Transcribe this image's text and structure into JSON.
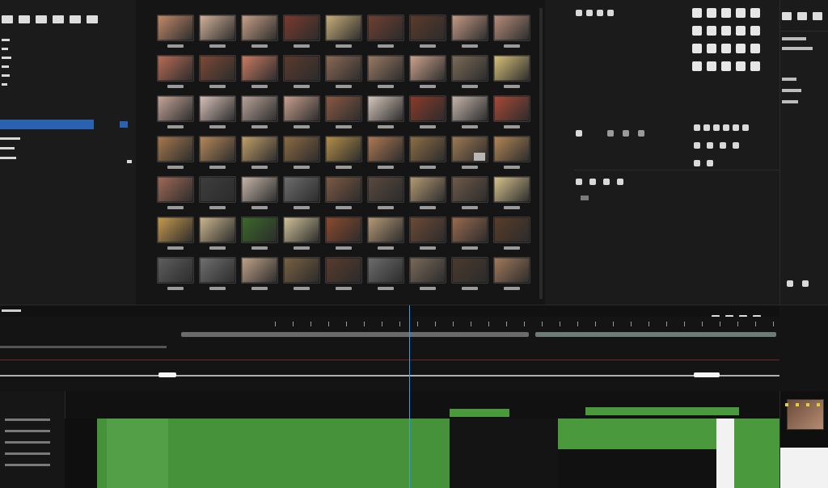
{
  "colors": {
    "bg": "#161616",
    "panel": "#1b1b1b",
    "selection": "#2a62b0",
    "accent_blue": "#2aa1ff",
    "accent_green": "#4a9a3d",
    "accent_yellow": "#e6d03a"
  },
  "icons": {
    "top_left_tabs": [
      "tab-icon",
      "tab-icon",
      "tab-icon",
      "tab-icon",
      "tab-icon",
      "tab-icon"
    ],
    "inspector_tools": [
      "tool-icon",
      "tool-icon",
      "tool-icon",
      "tool-icon",
      "tool-icon",
      "tool-icon",
      "tool-icon",
      "tool-icon",
      "tool-icon",
      "tool-icon",
      "tool-icon",
      "tool-icon",
      "tool-icon",
      "tool-icon",
      "tool-icon",
      "tool-icon",
      "tool-icon",
      "tool-icon",
      "tool-icon",
      "tool-icon"
    ],
    "inspector_small_tools": [
      "tool-icon",
      "tool-icon",
      "tool-icon",
      "tool-icon",
      "tool-icon",
      "tool-icon",
      "tool-icon",
      "tool-icon",
      "tool-icon",
      "tool-icon",
      "tool-icon",
      "tool-icon"
    ],
    "right_panel_controls": [
      "control-icon",
      "control-icon",
      "control-icon",
      "control-icon",
      "control-icon",
      "control-icon"
    ]
  },
  "media_browser": {
    "thumbnails": [
      [
        "#c48b6a",
        "#d3b39a",
        "#c9a188",
        "#7b3b2e",
        "#c9b07b",
        "#704032",
        "#5c3b2b",
        "#c69b86",
        "#b78e7b"
      ],
      [
        "#b96d56",
        "#7d4a37",
        "#cc7c63",
        "#5b3a2c",
        "#8c6a55",
        "#9b7b64",
        "#cfa48f",
        "#7b6c57",
        "#d9c27a"
      ],
      [
        "#c7a79a",
        "#d8c2bb",
        "#b9a49a",
        "#caa18f",
        "#8b5a44",
        "#d8c9bf",
        "#8b3b2b",
        "#c7b7ad",
        "#a94a38"
      ],
      [
        "#a77a4f",
        "#b7895b",
        "#c3a06a",
        "#8d6b44",
        "#b5904a",
        "#b07a55",
        "#8e6e46",
        "#9f7a55",
        "#b38757"
      ],
      [
        "#a06a56",
        "#3e3e3e",
        "#c7b7a9",
        "#6e6e6e",
        "#7e5a44",
        "#5a4a3f",
        "#b59b74",
        "#6f5a4a",
        "#d8c48e"
      ],
      [
        "#c79b4e",
        "#cbb78e",
        "#3c6a2a",
        "#d2c39a",
        "#8d4b2e",
        "#b79b78",
        "#6e4a36",
        "#9b6b4f",
        "#5a3d2a"
      ],
      [
        "#5f5f5f",
        "#707070",
        "#c1a38a",
        "#7a6142",
        "#5a3b2e",
        "#6d6d6d",
        "#7a6a5a",
        "#4b3a2e",
        "#a27b5c"
      ]
    ]
  },
  "timeline": {
    "playhead_color": "#2aa1ff"
  }
}
